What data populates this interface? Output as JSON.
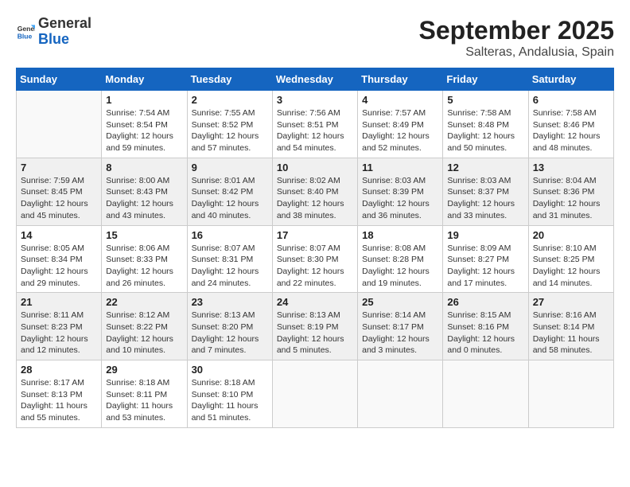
{
  "header": {
    "logo_general": "General",
    "logo_blue": "Blue",
    "month_title": "September 2025",
    "location": "Salteras, Andalusia, Spain"
  },
  "weekdays": [
    "Sunday",
    "Monday",
    "Tuesday",
    "Wednesday",
    "Thursday",
    "Friday",
    "Saturday"
  ],
  "weeks": [
    [
      {
        "date": "",
        "info": ""
      },
      {
        "date": "1",
        "info": "Sunrise: 7:54 AM\nSunset: 8:54 PM\nDaylight: 12 hours\nand 59 minutes."
      },
      {
        "date": "2",
        "info": "Sunrise: 7:55 AM\nSunset: 8:52 PM\nDaylight: 12 hours\nand 57 minutes."
      },
      {
        "date": "3",
        "info": "Sunrise: 7:56 AM\nSunset: 8:51 PM\nDaylight: 12 hours\nand 54 minutes."
      },
      {
        "date": "4",
        "info": "Sunrise: 7:57 AM\nSunset: 8:49 PM\nDaylight: 12 hours\nand 52 minutes."
      },
      {
        "date": "5",
        "info": "Sunrise: 7:58 AM\nSunset: 8:48 PM\nDaylight: 12 hours\nand 50 minutes."
      },
      {
        "date": "6",
        "info": "Sunrise: 7:58 AM\nSunset: 8:46 PM\nDaylight: 12 hours\nand 48 minutes."
      }
    ],
    [
      {
        "date": "7",
        "info": "Sunrise: 7:59 AM\nSunset: 8:45 PM\nDaylight: 12 hours\nand 45 minutes."
      },
      {
        "date": "8",
        "info": "Sunrise: 8:00 AM\nSunset: 8:43 PM\nDaylight: 12 hours\nand 43 minutes."
      },
      {
        "date": "9",
        "info": "Sunrise: 8:01 AM\nSunset: 8:42 PM\nDaylight: 12 hours\nand 40 minutes."
      },
      {
        "date": "10",
        "info": "Sunrise: 8:02 AM\nSunset: 8:40 PM\nDaylight: 12 hours\nand 38 minutes."
      },
      {
        "date": "11",
        "info": "Sunrise: 8:03 AM\nSunset: 8:39 PM\nDaylight: 12 hours\nand 36 minutes."
      },
      {
        "date": "12",
        "info": "Sunrise: 8:03 AM\nSunset: 8:37 PM\nDaylight: 12 hours\nand 33 minutes."
      },
      {
        "date": "13",
        "info": "Sunrise: 8:04 AM\nSunset: 8:36 PM\nDaylight: 12 hours\nand 31 minutes."
      }
    ],
    [
      {
        "date": "14",
        "info": "Sunrise: 8:05 AM\nSunset: 8:34 PM\nDaylight: 12 hours\nand 29 minutes."
      },
      {
        "date": "15",
        "info": "Sunrise: 8:06 AM\nSunset: 8:33 PM\nDaylight: 12 hours\nand 26 minutes."
      },
      {
        "date": "16",
        "info": "Sunrise: 8:07 AM\nSunset: 8:31 PM\nDaylight: 12 hours\nand 24 minutes."
      },
      {
        "date": "17",
        "info": "Sunrise: 8:07 AM\nSunset: 8:30 PM\nDaylight: 12 hours\nand 22 minutes."
      },
      {
        "date": "18",
        "info": "Sunrise: 8:08 AM\nSunset: 8:28 PM\nDaylight: 12 hours\nand 19 minutes."
      },
      {
        "date": "19",
        "info": "Sunrise: 8:09 AM\nSunset: 8:27 PM\nDaylight: 12 hours\nand 17 minutes."
      },
      {
        "date": "20",
        "info": "Sunrise: 8:10 AM\nSunset: 8:25 PM\nDaylight: 12 hours\nand 14 minutes."
      }
    ],
    [
      {
        "date": "21",
        "info": "Sunrise: 8:11 AM\nSunset: 8:23 PM\nDaylight: 12 hours\nand 12 minutes."
      },
      {
        "date": "22",
        "info": "Sunrise: 8:12 AM\nSunset: 8:22 PM\nDaylight: 12 hours\nand 10 minutes."
      },
      {
        "date": "23",
        "info": "Sunrise: 8:13 AM\nSunset: 8:20 PM\nDaylight: 12 hours\nand 7 minutes."
      },
      {
        "date": "24",
        "info": "Sunrise: 8:13 AM\nSunset: 8:19 PM\nDaylight: 12 hours\nand 5 minutes."
      },
      {
        "date": "25",
        "info": "Sunrise: 8:14 AM\nSunset: 8:17 PM\nDaylight: 12 hours\nand 3 minutes."
      },
      {
        "date": "26",
        "info": "Sunrise: 8:15 AM\nSunset: 8:16 PM\nDaylight: 12 hours\nand 0 minutes."
      },
      {
        "date": "27",
        "info": "Sunrise: 8:16 AM\nSunset: 8:14 PM\nDaylight: 11 hours\nand 58 minutes."
      }
    ],
    [
      {
        "date": "28",
        "info": "Sunrise: 8:17 AM\nSunset: 8:13 PM\nDaylight: 11 hours\nand 55 minutes."
      },
      {
        "date": "29",
        "info": "Sunrise: 8:18 AM\nSunset: 8:11 PM\nDaylight: 11 hours\nand 53 minutes."
      },
      {
        "date": "30",
        "info": "Sunrise: 8:18 AM\nSunset: 8:10 PM\nDaylight: 11 hours\nand 51 minutes."
      },
      {
        "date": "",
        "info": ""
      },
      {
        "date": "",
        "info": ""
      },
      {
        "date": "",
        "info": ""
      },
      {
        "date": "",
        "info": ""
      }
    ]
  ]
}
